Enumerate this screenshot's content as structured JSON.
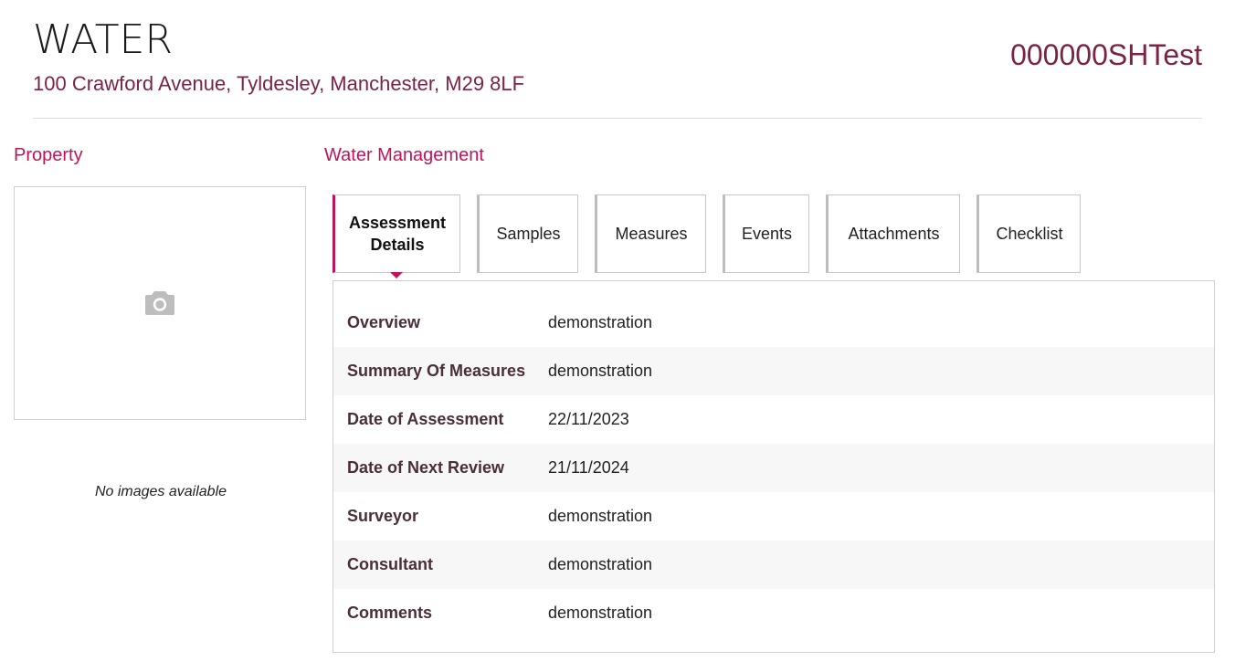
{
  "header": {
    "title": "WATER",
    "address": "100 Crawford Avenue, Tyldesley, Manchester, M29 8LF",
    "reference": "000000SHTest"
  },
  "property": {
    "heading": "Property",
    "no_images_text": "No images available",
    "placeholder_icon": "camera-icon"
  },
  "water_management": {
    "heading": "Water Management",
    "tabs": [
      {
        "label": "Assessment Details",
        "active": true
      },
      {
        "label": "Samples"
      },
      {
        "label": "Measures"
      },
      {
        "label": "Events"
      },
      {
        "label": "Attachments"
      },
      {
        "label": "Checklist"
      }
    ],
    "details": [
      {
        "label": "Overview",
        "value": "demonstration"
      },
      {
        "label": "Summary Of Measures",
        "value": "demonstration"
      },
      {
        "label": "Date of Assessment",
        "value": "22/11/2023"
      },
      {
        "label": "Date of Next Review",
        "value": "21/11/2024"
      },
      {
        "label": "Surveyor",
        "value": "demonstration"
      },
      {
        "label": "Consultant",
        "value": "demonstration"
      },
      {
        "label": "Comments",
        "value": "demonstration"
      }
    ]
  },
  "colors": {
    "accent": "#c0135a",
    "brand_text": "#7a2346",
    "label_text": "#4a2f3b",
    "alt_row": "#f7f7f7",
    "border": "#cfcfcf"
  }
}
